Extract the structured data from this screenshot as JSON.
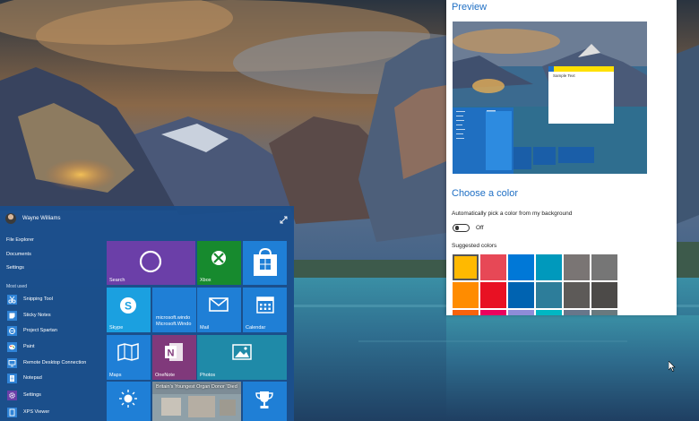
{
  "start_menu": {
    "user_name": "Wayne Williams",
    "nav_items": [
      "File Explorer",
      "Documents",
      "Settings"
    ],
    "most_used_label": "Most used",
    "apps": [
      {
        "label": "Snipping Tool",
        "icon": "scissors-icon"
      },
      {
        "label": "Sticky Notes",
        "icon": "sticky-note-icon"
      },
      {
        "label": "Project Spartan",
        "icon": "globe-icon"
      },
      {
        "label": "Paint",
        "icon": "paint-palette-icon"
      },
      {
        "label": "Remote Desktop Connection",
        "icon": "remote-desktop-icon"
      },
      {
        "label": "Notepad",
        "icon": "notepad-icon"
      },
      {
        "label": "Settings",
        "icon": "gear-icon"
      },
      {
        "label": "XPS Viewer",
        "icon": "document-icon"
      }
    ],
    "tiles": {
      "search": "Search",
      "xbox": "Xbox",
      "skype": "Skype",
      "msn_text": "microsoft.windo\nMicrosoft.Windo",
      "mail": "Mail",
      "calendar": "Calendar",
      "maps": "Maps",
      "onenote": "OneNote",
      "photos": "Photos",
      "news_headline": "Britain's Youngest Organ Donor 'Died"
    },
    "colors": {
      "menu_bg": "#194e8c",
      "search_tile": "#6b3fa8",
      "xbox_tile": "#178a2e",
      "skype_tile": "#1ba0e0",
      "onenote_tile": "#80397b",
      "photos_tile": "#1f8aa8"
    }
  },
  "settings": {
    "preview_heading": "Preview",
    "preview_sample_text": "Sample Text",
    "choose_color_heading": "Choose a color",
    "auto_pick_label": "Automatically pick a color from my background",
    "auto_pick_state": "Off",
    "suggested_colors_label": "Suggested colors",
    "suggested_colors_row1": [
      "#ffb900",
      "#e74856",
      "#0078d7",
      "#0099bc",
      "#7a7574",
      "#767676"
    ],
    "suggested_colors_row2": [
      "#ff8c00",
      "#e81123",
      "#0063b1",
      "#2d7d9a",
      "#5d5a58",
      "#4c4a48"
    ],
    "suggested_colors_row3": [
      "#f7630c",
      "#ea005e",
      "#8e8cd8",
      "#00b7c3",
      "#68768a",
      "#69797e"
    ]
  }
}
